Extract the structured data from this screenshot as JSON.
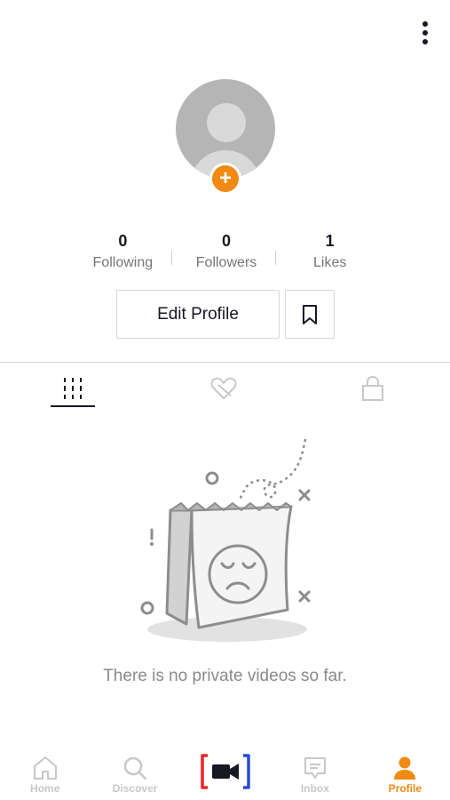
{
  "profile": {
    "stats": [
      {
        "value": "0",
        "label": "Following"
      },
      {
        "value": "0",
        "label": "Followers"
      },
      {
        "value": "1",
        "label": "Likes"
      }
    ],
    "edit_profile_label": "Edit Profile",
    "accent_color": "#f08a12"
  },
  "tabs": [
    {
      "icon": "grid-icon",
      "active": true
    },
    {
      "icon": "liked-heart-icon",
      "active": false
    },
    {
      "icon": "lock-icon",
      "active": false
    }
  ],
  "empty_state": {
    "message": "There is no private videos so far."
  },
  "bottom_nav": {
    "items": [
      {
        "label": "Home",
        "icon": "home-icon"
      },
      {
        "label": "Discover",
        "icon": "search-icon"
      },
      {
        "label": "",
        "icon": "record-video-icon"
      },
      {
        "label": "Inbox",
        "icon": "inbox-icon"
      },
      {
        "label": "Profile",
        "icon": "profile-icon",
        "active": true
      }
    ]
  }
}
